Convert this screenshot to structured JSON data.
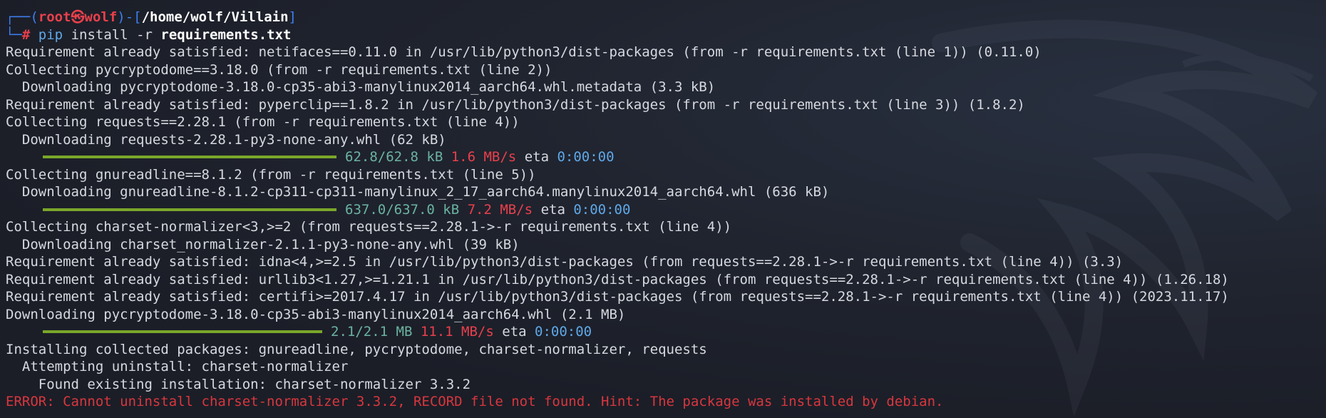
{
  "prompt": {
    "frame_top": "┌──(",
    "user": "root㉿wolf",
    "sep": ")-[",
    "path": "/home/wolf/Villain",
    "close": "]",
    "frame_bottom": "└─",
    "hash": "#",
    "command": "pip",
    "args": "install -r",
    "file": "requirements.txt"
  },
  "lines": {
    "l1": "Requirement already satisfied: netifaces==0.11.0 in /usr/lib/python3/dist-packages (from -r requirements.txt (line 1)) (0.11.0)",
    "l2": "Collecting pycryptodome==3.18.0 (from -r requirements.txt (line 2))",
    "l3": "  Downloading pycryptodome-3.18.0-cp35-abi3-manylinux2014_aarch64.whl.metadata (3.3 kB)",
    "l4": "Requirement already satisfied: pyperclip==1.8.2 in /usr/lib/python3/dist-packages (from -r requirements.txt (line 3)) (1.8.2)",
    "l5": "Collecting requests==2.28.1 (from -r requirements.txt (line 4))",
    "l6": "  Downloading requests-2.28.1-py3-none-any.whl (62 kB)",
    "l8": "Collecting gnureadline==8.1.2 (from -r requirements.txt (line 5))",
    "l9": "  Downloading gnureadline-8.1.2-cp311-cp311-manylinux_2_17_aarch64.manylinux2014_aarch64.whl (636 kB)",
    "l11": "Collecting charset-normalizer<3,>=2 (from requests==2.28.1->-r requirements.txt (line 4))",
    "l12": "  Downloading charset_normalizer-2.1.1-py3-none-any.whl (39 kB)",
    "l13": "Requirement already satisfied: idna<4,>=2.5 in /usr/lib/python3/dist-packages (from requests==2.28.1->-r requirements.txt (line 4)) (3.3)",
    "l14": "Requirement already satisfied: urllib3<1.27,>=1.21.1 in /usr/lib/python3/dist-packages (from requests==2.28.1->-r requirements.txt (line 4)) (1.26.18)",
    "l15": "Requirement already satisfied: certifi>=2017.4.17 in /usr/lib/python3/dist-packages (from requests==2.28.1->-r requirements.txt (line 4)) (2023.11.17)",
    "l16": "Downloading pycryptodome-3.18.0-cp35-abi3-manylinux2014_aarch64.whl (2.1 MB)",
    "l18": "Installing collected packages: gnureadline, pycryptodome, charset-normalizer, requests",
    "l19": "  Attempting uninstall: charset-normalizer",
    "l20": "    Found existing installation: charset-normalizer 3.3.2",
    "l21": "ERROR: Cannot uninstall charset-normalizer 3.3.2, RECORD file not found. Hint: The package was installed by debian."
  },
  "progress": [
    {
      "size": "62.8/62.8 kB",
      "speed": "1.6 MB/s",
      "eta_label": "eta",
      "eta": "0:00:00",
      "fraction": 1.0
    },
    {
      "size": "637.0/637.0 kB",
      "speed": "7.2 MB/s",
      "eta_label": "eta",
      "eta": "0:00:00",
      "fraction": 1.0
    },
    {
      "size": "2.1/2.1 MB",
      "speed": "11.1 MB/s",
      "eta_label": "eta",
      "eta": "0:00:00",
      "fraction": 1.0
    }
  ],
  "colors": {
    "background": "#1d2029",
    "prompt_frame": "#3d7ff0",
    "prompt_user": "#e8404c",
    "progress_bar": "#7aa62a",
    "size": "#6bb3a2",
    "speed": "#e8404c",
    "eta": "#5fa8e8",
    "error": "#d9363e"
  },
  "icons": {
    "watermark": "kali-dragon-watermark-icon"
  }
}
